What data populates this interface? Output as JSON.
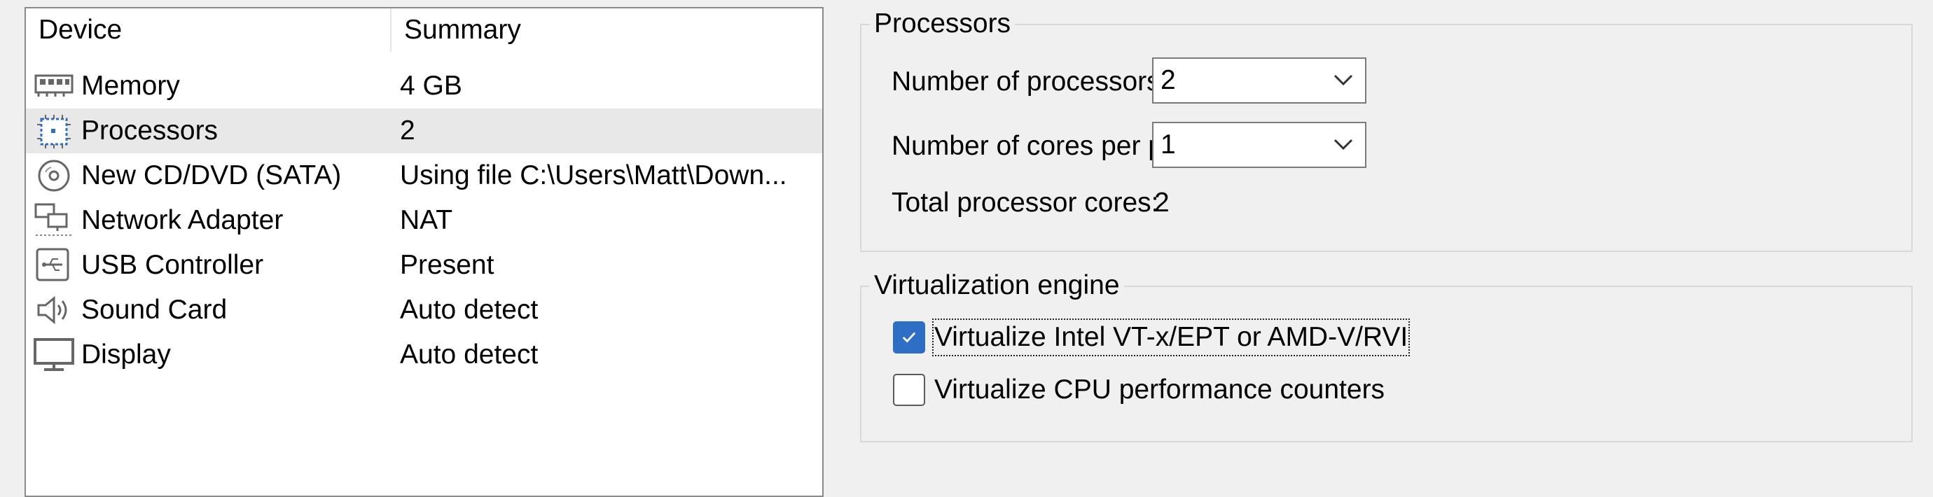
{
  "device_list": {
    "columns": {
      "device": "Device",
      "summary": "Summary"
    },
    "rows": [
      {
        "icon": "memory-icon",
        "name": "Memory",
        "summary": "4 GB",
        "selected": false
      },
      {
        "icon": "processor-icon",
        "name": "Processors",
        "summary": "2",
        "selected": true
      },
      {
        "icon": "cd-dvd-icon",
        "name": "New CD/DVD (SATA)",
        "summary": "Using file C:\\Users\\Matt\\Down...",
        "selected": false
      },
      {
        "icon": "network-adapter-icon",
        "name": "Network Adapter",
        "summary": "NAT",
        "selected": false
      },
      {
        "icon": "usb-icon",
        "name": "USB Controller",
        "summary": "Present",
        "selected": false
      },
      {
        "icon": "speaker-icon",
        "name": "Sound Card",
        "summary": "Auto detect",
        "selected": false
      },
      {
        "icon": "monitor-icon",
        "name": "Display",
        "summary": "Auto detect",
        "selected": false
      }
    ]
  },
  "processors": {
    "title": "Processors",
    "num_processors_label": "Number of processors:",
    "num_processors_value": "2",
    "cores_per_processor_label": "Number of cores per processor:",
    "cores_per_processor_value": "1",
    "total_cores_label": "Total processor cores:",
    "total_cores_value": "2"
  },
  "virtualization": {
    "title": "Virtualization engine",
    "vtx_label": "Virtualize Intel VT-x/EPT or AMD-V/RVI",
    "vtx_checked": true,
    "perf_counters_label": "Virtualize CPU performance counters",
    "perf_counters_checked": false
  },
  "colors": {
    "accent": "#2f6ec5",
    "selected_row": "#e8e8e8",
    "window_bg": "#f0f0f0"
  }
}
